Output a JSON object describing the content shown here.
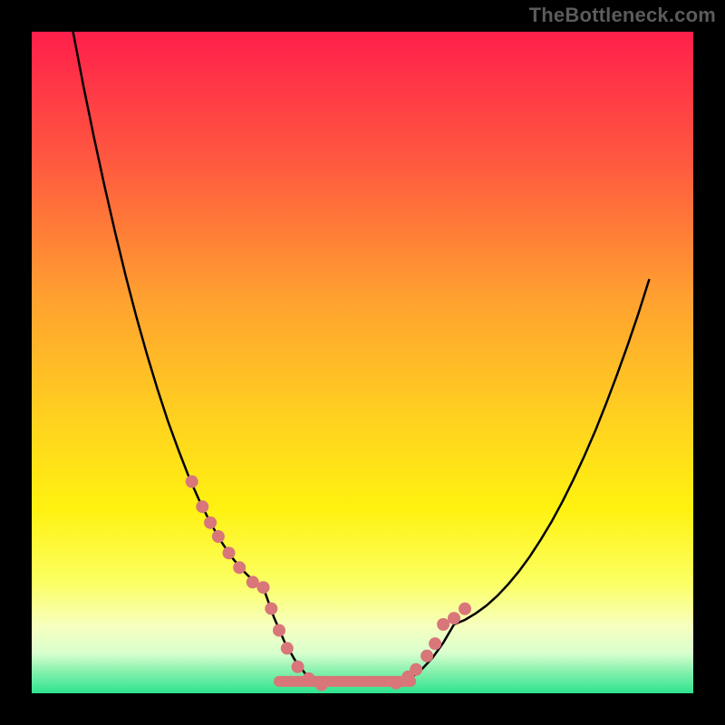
{
  "watermark": "TheBottleneck.com",
  "colors": {
    "frame": "#000000",
    "curve": "#000000",
    "marker_fill": "#d87679",
    "gradient_stops": [
      {
        "offset": 0.0,
        "color": "#ff1f4b"
      },
      {
        "offset": 0.2,
        "color": "#ff5a3f"
      },
      {
        "offset": 0.4,
        "color": "#ffa030"
      },
      {
        "offset": 0.58,
        "color": "#ffd020"
      },
      {
        "offset": 0.72,
        "color": "#fff210"
      },
      {
        "offset": 0.83,
        "color": "#fcff60"
      },
      {
        "offset": 0.9,
        "color": "#f6ffc0"
      },
      {
        "offset": 0.94,
        "color": "#d8ffce"
      },
      {
        "offset": 0.965,
        "color": "#8cf2af"
      },
      {
        "offset": 1.0,
        "color": "#2de38f"
      }
    ]
  },
  "chart_data": {
    "type": "line",
    "title": "",
    "xlabel": "",
    "ylabel": "",
    "xlim": [
      0,
      1
    ],
    "ylim": [
      0,
      1
    ],
    "curve": {
      "x": [
        0.0,
        0.02,
        0.04,
        0.06,
        0.08,
        0.1,
        0.12,
        0.14,
        0.16,
        0.18,
        0.2,
        0.22,
        0.24,
        0.26,
        0.28,
        0.3,
        0.32,
        0.34,
        0.36,
        0.38,
        0.4,
        0.42,
        0.44,
        0.46,
        0.48,
        0.5,
        0.52,
        0.54,
        0.56,
        0.58,
        0.6,
        0.62,
        0.64,
        0.66,
        0.68,
        0.7,
        0.72,
        0.74,
        0.76,
        0.78,
        0.8,
        0.82,
        0.84,
        0.86,
        0.88,
        0.9,
        0.92,
        0.94,
        0.96,
        0.98,
        1.0
      ],
      "y": [
        1.18,
        1.089,
        1.002,
        0.919,
        0.841,
        0.767,
        0.697,
        0.631,
        0.57,
        0.513,
        0.46,
        0.411,
        0.367,
        0.326,
        0.29,
        0.258,
        0.23,
        0.206,
        0.187,
        0.171,
        0.16,
        0.115,
        0.078,
        0.05,
        0.029,
        0.017,
        0.013,
        0.017,
        0.029,
        0.05,
        0.078,
        0.115,
        0.16,
        0.171,
        0.187,
        0.206,
        0.23,
        0.258,
        0.29,
        0.326,
        0.367,
        0.411,
        0.46,
        0.513,
        0.57,
        0.631,
        0.697,
        0.767,
        0.841,
        0.919,
        1.002
      ]
    },
    "markers": {
      "x": [
        0.265,
        0.285,
        0.3,
        0.315,
        0.335,
        0.355,
        0.38,
        0.4,
        0.415,
        0.43,
        0.445,
        0.465,
        0.486,
        0.51,
        0.533,
        0.555,
        0.57,
        0.59,
        0.605,
        0.62,
        0.64,
        0.66
      ],
      "y": [
        0.32,
        0.282,
        0.258,
        0.237,
        0.212,
        0.19,
        0.168,
        0.16,
        0.128,
        0.095,
        0.068,
        0.04,
        0.022,
        0.013,
        0.017,
        0.032,
        0.05,
        0.083,
        0.113,
        0.16,
        0.175,
        0.198
      ]
    },
    "flat_segment": {
      "x": [
        0.43,
        0.56
      ],
      "y": 0.018
    }
  }
}
